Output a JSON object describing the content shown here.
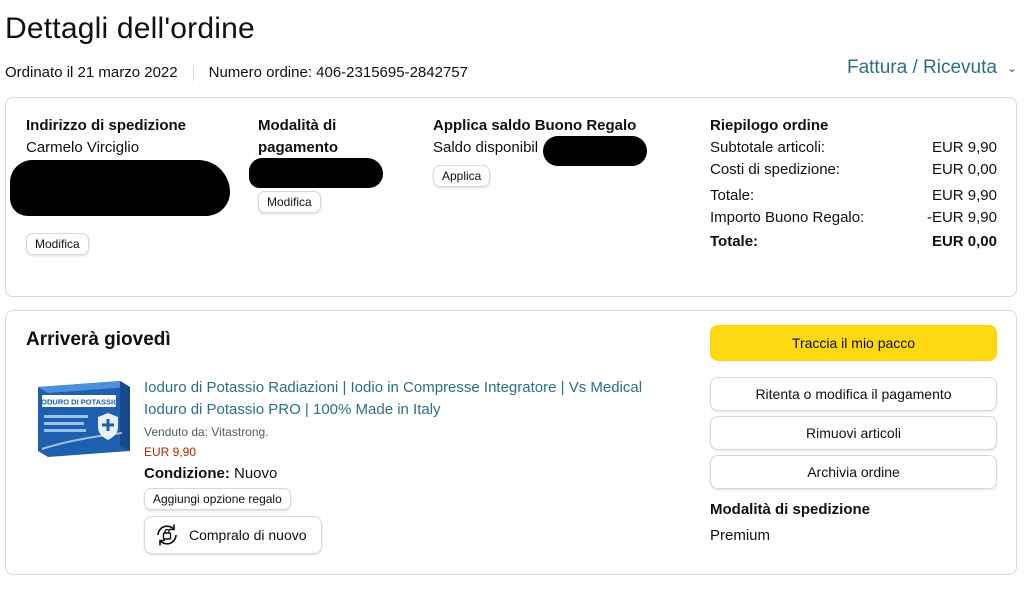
{
  "header": {
    "title": "Dettagli dell'ordine",
    "ordered_on": "Ordinato il 21 marzo 2022",
    "order_number": "Numero ordine: 406-2315695-2842757",
    "invoice_label": "Fattura / Ricevuta"
  },
  "shipping_address": {
    "heading": "Indirizzo di spedizione",
    "name": "Carmelo Virciglio",
    "edit_label": "Modifica"
  },
  "payment": {
    "heading": "Modalità di pagamento",
    "edit_label": "Modifica"
  },
  "gift_card": {
    "heading": "Applica saldo Buono Regalo",
    "balance_label": "Saldo disponibil",
    "apply_label": "Applica"
  },
  "summary": {
    "heading": "Riepilogo ordine",
    "rows": [
      {
        "label": "Subtotale articoli:",
        "value": "EUR 9,90"
      },
      {
        "label": "Costi di spedizione:",
        "value": "EUR 0,00"
      },
      {
        "label": "Totale:",
        "value": "EUR 9,90"
      },
      {
        "label": "Importo Buono Regalo:",
        "value": "-EUR 9,90"
      }
    ],
    "grand_total_label": "Totale:",
    "grand_total_value": "EUR 0,00"
  },
  "shipment": {
    "arrival": "Arriverà giovedì",
    "product": {
      "title_line1": "Ioduro di Potassio Radiazioni | Iodio in Compresse Integratore | Vs Medical",
      "title_line2": "Ioduro di Potassio PRO | 100% Made in Italy",
      "sold_by": "Venduto da: Vitastrong.",
      "price": "EUR 9,90",
      "condition_label": "Condizione:",
      "condition_value": "Nuovo",
      "gift_option_label": "Aggiungi opzione regalo",
      "buy_again_label": "Compralo di nuovo",
      "image_text": "IODURO DI POTASSIO"
    },
    "actions": {
      "track": "Traccia il mio pacco",
      "retry_payment": "Ritenta o modifica il pagamento",
      "remove_items": "Rimuovi articoli",
      "archive": "Archivia ordine"
    },
    "shipping_mode_heading": "Modalità di spedizione",
    "shipping_mode_value": "Premium"
  },
  "colors": {
    "link": "#2b6f86",
    "price": "#b12704",
    "primary_button": "#ffd814",
    "border": "#d5d9d9"
  }
}
